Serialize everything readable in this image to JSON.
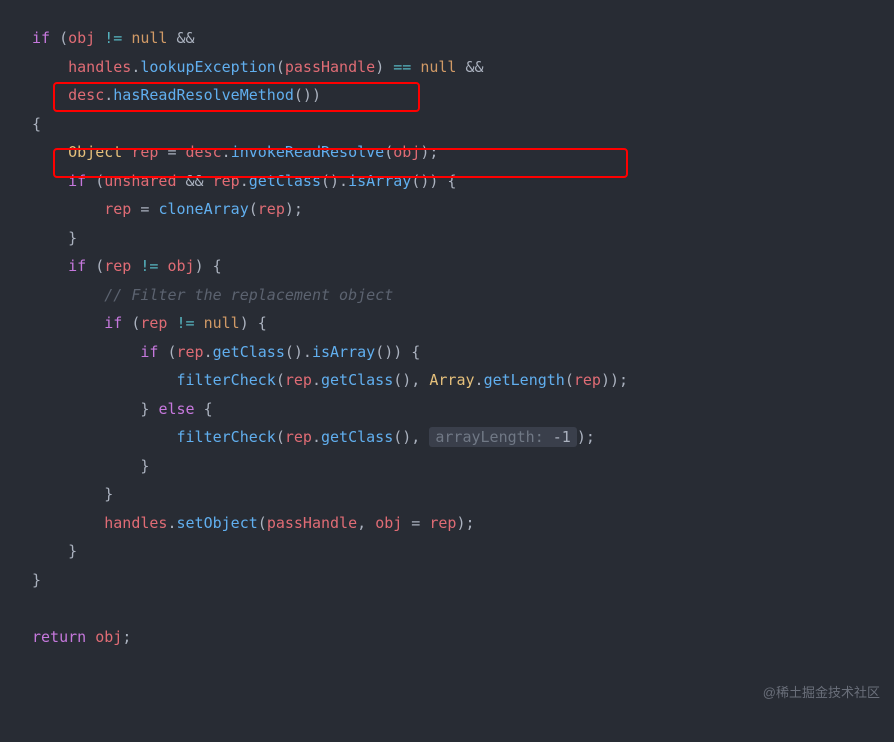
{
  "code": {
    "l1": {
      "kw": "if",
      "punc1": " (",
      "var": "obj",
      "op": " != ",
      "null": "null",
      "punc2": " &&"
    },
    "l2": {
      "indent": "    ",
      "var": "handles",
      "punc1": ".",
      "method": "lookupException",
      "punc2": "(",
      "var2": "passHandle",
      "punc3": ") ",
      "op": "==",
      "punc4": " ",
      "null": "null",
      "punc5": " &&"
    },
    "l3": {
      "indent": "    ",
      "var": "desc",
      "punc1": ".",
      "method": "hasReadResolveMethod",
      "punc2": "())"
    },
    "l4": {
      "punc": "{"
    },
    "l5": {
      "indent": "    ",
      "type": "Object",
      "punc1": " ",
      "var": "rep",
      "punc2": " = ",
      "var2": "desc",
      "punc3": ".",
      "method": "invokeReadResolve",
      "punc4": "(",
      "var3": "obj",
      "punc5": ");"
    },
    "l6": {
      "indent": "    ",
      "kw": "if",
      "punc1": " (",
      "var": "unshared",
      "punc2": " && ",
      "var2": "rep",
      "punc3": ".",
      "method": "getClass",
      "punc4": "().",
      "method2": "isArray",
      "punc5": "()) {"
    },
    "l7": {
      "indent": "        ",
      "var": "rep",
      "punc1": " = ",
      "method": "cloneArray",
      "punc2": "(",
      "var2": "rep",
      "punc3": ");"
    },
    "l8": {
      "indent": "    ",
      "punc": "}"
    },
    "l9": {
      "indent": "    ",
      "kw": "if",
      "punc1": " (",
      "var": "rep",
      "op": " != ",
      "var2": "obj",
      "punc2": ") {"
    },
    "l10": {
      "indent": "        ",
      "comment": "// Filter the replacement object"
    },
    "l11": {
      "indent": "        ",
      "kw": "if",
      "punc1": " (",
      "var": "rep",
      "op": " != ",
      "null": "null",
      "punc2": ") {"
    },
    "l12": {
      "indent": "            ",
      "kw": "if",
      "punc1": " (",
      "var": "rep",
      "punc2": ".",
      "method": "getClass",
      "punc3": "().",
      "method2": "isArray",
      "punc4": "()) {"
    },
    "l13": {
      "indent": "                ",
      "method": "filterCheck",
      "punc1": "(",
      "var": "rep",
      "punc2": ".",
      "method2": "getClass",
      "punc3": "(), ",
      "type": "Array",
      "punc4": ".",
      "method3": "getLength",
      "punc5": "(",
      "var2": "rep",
      "punc6": "));"
    },
    "l14": {
      "indent": "            ",
      "punc1": "} ",
      "kw": "else",
      "punc2": " {"
    },
    "l15": {
      "indent": "                ",
      "method": "filterCheck",
      "punc1": "(",
      "var": "rep",
      "punc2": ".",
      "method2": "getClass",
      "punc3": "(), ",
      "hint_label": "arrayLength:",
      "hint_val": " -1",
      "punc4": ");"
    },
    "l16": {
      "indent": "            ",
      "punc": "}"
    },
    "l17": {
      "indent": "        ",
      "punc": "}"
    },
    "l18": {
      "indent": "        ",
      "var": "handles",
      "punc1": ".",
      "method": "setObject",
      "punc2": "(",
      "var2": "passHandle",
      "punc3": ", ",
      "var3": "obj",
      "punc4": " = ",
      "var4": "rep",
      "punc5": ");"
    },
    "l19": {
      "indent": "    ",
      "punc": "}"
    },
    "l20": {
      "punc": "}"
    },
    "l21": {
      "blank": " "
    },
    "l22": {
      "kw": "return",
      "punc1": " ",
      "var": "obj",
      "punc2": ";"
    }
  },
  "watermark": "@稀土掘金技术社区"
}
